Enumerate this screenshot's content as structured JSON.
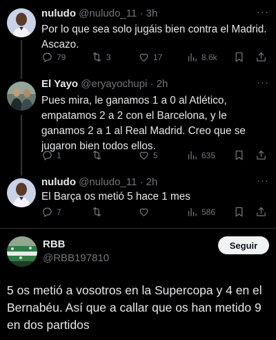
{
  "tweets": [
    {
      "name": "nuludo",
      "handle": "@nuludo_11",
      "time": "· 3h",
      "text": "Por lo que sea solo jugáis bien contra el Madrid. Ascazo.",
      "replies": "79",
      "retweets": "3",
      "likes": "17",
      "views": "8.6k"
    },
    {
      "name": "El Yayo",
      "handle": "@eryayochupi",
      "time": "· 2h",
      "text": "Pues mira, le ganamos 1 a 0 al Atlético, empatamos 2 a 2 con el Barcelona, y le ganamos 2 a 1 al Real Madrid. Creo que se jugaron bien todos ellos.",
      "replies": "1",
      "retweets": "",
      "likes": "5",
      "views": "635"
    },
    {
      "name": "nuludo",
      "handle": "@nuludo_11",
      "time": "· 2h",
      "text": "El Barça os metió 5 hace 1 mes",
      "replies": "7",
      "retweets": "",
      "likes": "",
      "views": "586"
    }
  ],
  "main_tweet": {
    "name": "RBB",
    "handle": "@RBB197810",
    "follow_label": "Seguir",
    "text": "5 os metió a vosotros en la Supercopa y 4 en el Bernabéu. Así que a callar que os han metido 9 en dos partidos"
  },
  "more_icon": "···",
  "colors": {
    "background": "#000000",
    "text": "#e7e9ea",
    "muted": "#71767b",
    "follow_bg": "#eff3f4"
  }
}
